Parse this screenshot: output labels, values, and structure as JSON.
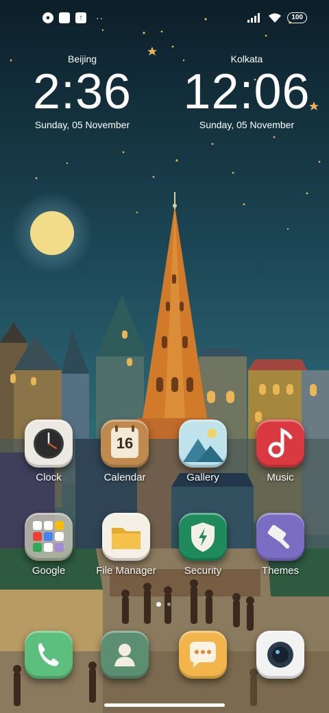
{
  "status_bar": {
    "left_icons": [
      "notification-icon",
      "square-app-icon",
      "upload-icon"
    ],
    "more": "··",
    "right_icons": [
      "signal-icon",
      "wifi-icon"
    ],
    "battery": "100"
  },
  "clocks": [
    {
      "city": "Beijing",
      "time": "2:36",
      "date": "Sunday, 05 November"
    },
    {
      "city": "Kolkata",
      "time": "12:06",
      "date": "Sunday, 05 November"
    }
  ],
  "apps": [
    {
      "label": "Clock",
      "icon": "clock-icon"
    },
    {
      "label": "Calendar",
      "icon": "calendar-icon",
      "calendar_day": "16"
    },
    {
      "label": "Gallery",
      "icon": "gallery-icon"
    },
    {
      "label": "Music",
      "icon": "music-icon"
    },
    {
      "label": "Google",
      "icon": "google-folder-icon"
    },
    {
      "label": "File Manager",
      "icon": "folder-icon"
    },
    {
      "label": "Security",
      "icon": "shield-icon"
    },
    {
      "label": "Themes",
      "icon": "paintbrush-icon"
    }
  ],
  "dock": [
    {
      "name": "Phone",
      "icon": "phone-icon"
    },
    {
      "name": "Contacts",
      "icon": "contacts-icon"
    },
    {
      "name": "Messages",
      "icon": "message-icon"
    },
    {
      "name": "Camera",
      "icon": "camera-icon"
    }
  ],
  "colors": {
    "sky_top": "#0c1f29",
    "sky_bottom": "#2d6875",
    "moon": "#f2dc8a",
    "tower": "#d17a2a"
  }
}
